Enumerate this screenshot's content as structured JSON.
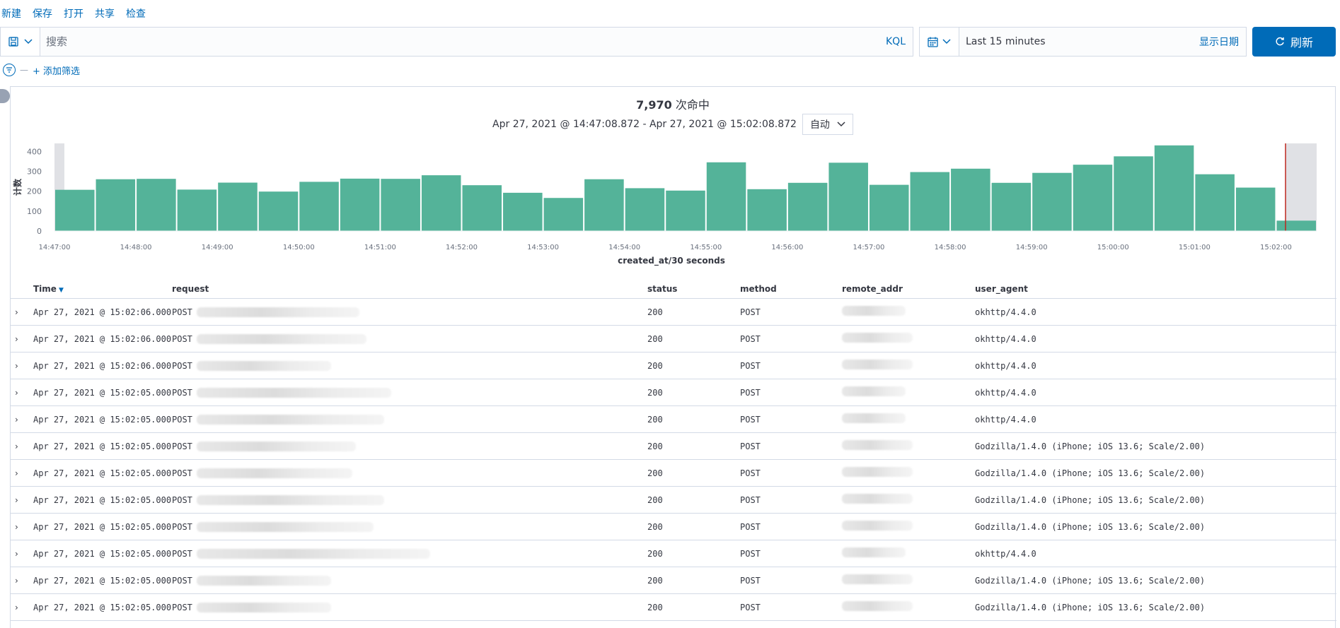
{
  "topmenu": [
    "新建",
    "保存",
    "打开",
    "共享",
    "检查"
  ],
  "search": {
    "placeholder": "搜索",
    "language": "KQL"
  },
  "datepicker": {
    "range": "Last 15 minutes",
    "show_dates": "显示日期"
  },
  "refresh": {
    "label": "刷新"
  },
  "filter": {
    "add_label": "+ 添加筛选"
  },
  "summary": {
    "hits_count": "7,970",
    "hits_label": "次命中",
    "range": "Apr 27, 2021 @ 14:47:08.872 - Apr 27, 2021 @ 15:02:08.872",
    "interval": "自动"
  },
  "colors": {
    "bar": "#54b399",
    "accent": "#006bb8",
    "marker": "#bd271e"
  },
  "chart_data": {
    "type": "bar",
    "xlabel": "created_at/30 seconds",
    "ylabel": "计数",
    "ylim": [
      0,
      440
    ],
    "yticks": [
      0,
      100,
      200,
      300,
      400
    ],
    "xtick_labels": [
      "14:47:00",
      "14:48:00",
      "14:49:00",
      "14:50:00",
      "14:51:00",
      "14:52:00",
      "14:53:00",
      "14:54:00",
      "14:55:00",
      "14:56:00",
      "14:57:00",
      "14:58:00",
      "14:59:00",
      "15:00:00",
      "15:01:00",
      "15:02:00"
    ],
    "values": [
      207,
      260,
      262,
      208,
      243,
      198,
      247,
      263,
      262,
      280,
      230,
      192,
      166,
      260,
      215,
      203,
      345,
      210,
      242,
      343,
      232,
      296,
      313,
      242,
      292,
      333,
      375,
      430,
      285,
      218,
      52
    ],
    "current_time_marker": "15:02:08"
  },
  "table": {
    "columns": [
      "Time",
      "request",
      "status",
      "method",
      "remote_addr",
      "user_agent"
    ],
    "rows": [
      {
        "time": "Apr 27, 2021 @ 15:02:06.000",
        "request": "POST",
        "status": "200",
        "method": "POST",
        "ua": "okhttp/4.4.0"
      },
      {
        "time": "Apr 27, 2021 @ 15:02:06.000",
        "request": "POST",
        "status": "200",
        "method": "POST",
        "ua": "okhttp/4.4.0"
      },
      {
        "time": "Apr 27, 2021 @ 15:02:06.000",
        "request": "POST",
        "status": "200",
        "method": "POST",
        "ua": "okhttp/4.4.0"
      },
      {
        "time": "Apr 27, 2021 @ 15:02:05.000",
        "request": "POST",
        "status": "200",
        "method": "POST",
        "ua": "okhttp/4.4.0"
      },
      {
        "time": "Apr 27, 2021 @ 15:02:05.000",
        "request": "POST",
        "status": "200",
        "method": "POST",
        "ua": "okhttp/4.4.0"
      },
      {
        "time": "Apr 27, 2021 @ 15:02:05.000",
        "request": "POST",
        "status": "200",
        "method": "POST",
        "ua": "Godzilla/1.4.0 (iPhone; iOS 13.6; Scale/2.00)"
      },
      {
        "time": "Apr 27, 2021 @ 15:02:05.000",
        "request": "POST",
        "status": "200",
        "method": "POST",
        "ua": "Godzilla/1.4.0 (iPhone; iOS 13.6; Scale/2.00)"
      },
      {
        "time": "Apr 27, 2021 @ 15:02:05.000",
        "request": "POST",
        "status": "200",
        "method": "POST",
        "ua": "Godzilla/1.4.0 (iPhone; iOS 13.6; Scale/2.00)"
      },
      {
        "time": "Apr 27, 2021 @ 15:02:05.000",
        "request": "POST",
        "status": "200",
        "method": "POST",
        "ua": "Godzilla/1.4.0 (iPhone; iOS 13.6; Scale/2.00)"
      },
      {
        "time": "Apr 27, 2021 @ 15:02:05.000",
        "request": "POST",
        "status": "200",
        "method": "POST",
        "ua": "okhttp/4.4.0"
      },
      {
        "time": "Apr 27, 2021 @ 15:02:05.000",
        "request": "POST",
        "status": "200",
        "method": "POST",
        "ua": "Godzilla/1.4.0 (iPhone; iOS 13.6; Scale/2.00)"
      },
      {
        "time": "Apr 27, 2021 @ 15:02:05.000",
        "request": "POST",
        "status": "200",
        "method": "POST",
        "ua": "Godzilla/1.4.0 (iPhone; iOS 13.6; Scale/2.00)"
      }
    ]
  }
}
